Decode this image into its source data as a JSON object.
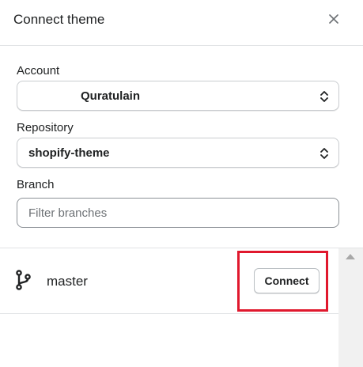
{
  "dialog": {
    "title": "Connect theme",
    "close_icon": "close-icon"
  },
  "form": {
    "account_label": "Account",
    "account_value": "Quratulain",
    "repository_label": "Repository",
    "repository_value": "shopify-theme",
    "branch_label": "Branch",
    "branch_placeholder": "Filter branches",
    "branch_value": ""
  },
  "branches": [
    {
      "icon": "git-branch-icon",
      "name": "master",
      "action_label": "Connect"
    }
  ],
  "colors": {
    "highlight": "#e0182d",
    "border": "#c9cccf",
    "text": "#202223"
  }
}
